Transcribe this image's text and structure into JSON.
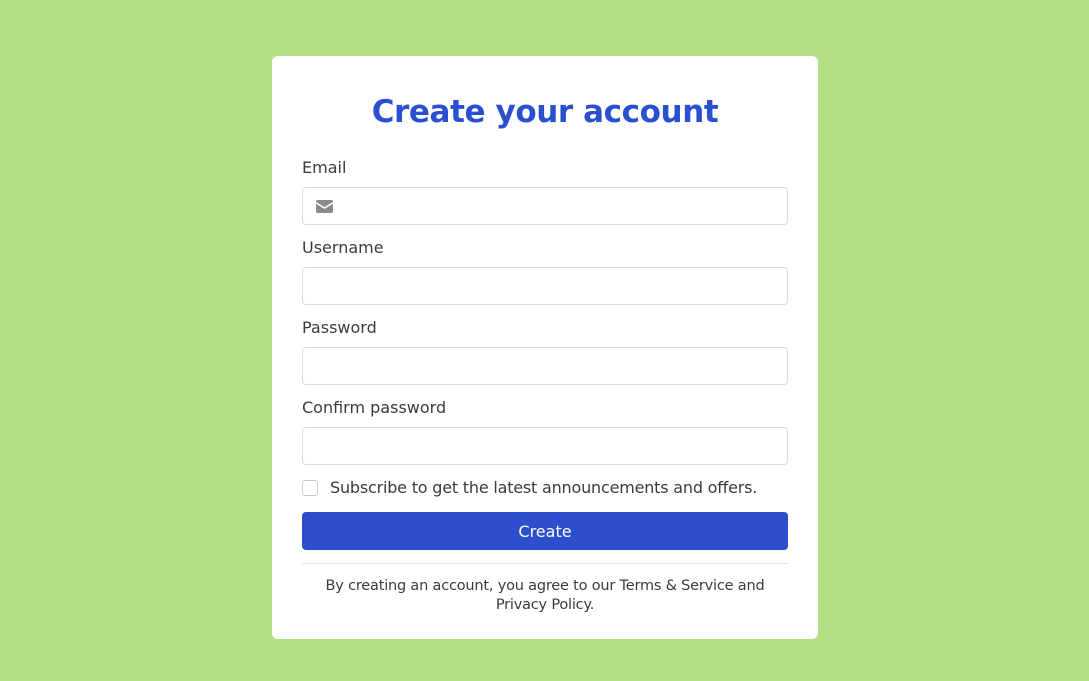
{
  "form": {
    "title": "Create your account",
    "fields": {
      "email": {
        "label": "Email",
        "value": "",
        "placeholder": ""
      },
      "username": {
        "label": "Username",
        "value": "",
        "placeholder": ""
      },
      "password": {
        "label": "Password",
        "value": "",
        "placeholder": ""
      },
      "confirm_password": {
        "label": "Confirm password",
        "value": "",
        "placeholder": ""
      }
    },
    "subscribe": {
      "label": "Subscribe to get the latest announcements and offers.",
      "checked": false
    },
    "submit_label": "Create",
    "footer": {
      "prefix": "By creating an account, you agree to our ",
      "terms_link": "Terms & Service",
      "middle": " and ",
      "privacy_link": "Privacy Policy",
      "suffix": "."
    }
  },
  "icons": {
    "email_field_icon": "envelope-icon"
  },
  "colors": {
    "page_background": "#b3e084",
    "card_background": "#ffffff",
    "title": "#2b4fd1",
    "button": "#2e4fcd",
    "button_text": "#ffffff",
    "text": "#3b3b3b",
    "icon": "#8a8a8a"
  }
}
